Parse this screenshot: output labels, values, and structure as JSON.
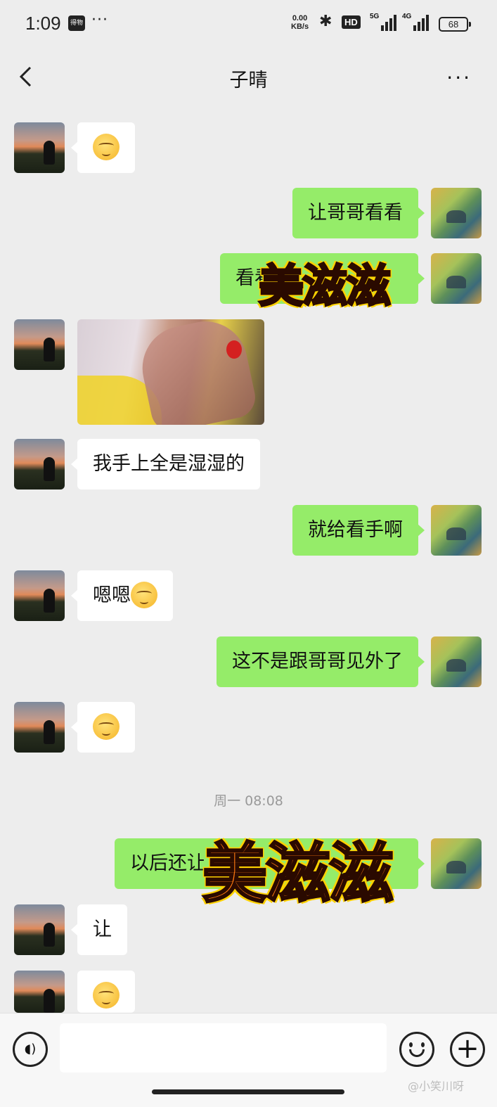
{
  "status_bar": {
    "time": "1:09",
    "app_badge": "得物",
    "dots": "···",
    "speed_value": "0.00",
    "speed_unit": "KB/s",
    "hd": "HD",
    "sig1": "5G",
    "sig2": "4G",
    "battery": "68"
  },
  "header": {
    "title": "子晴",
    "more": "···"
  },
  "messages": {
    "m2": "让哥哥看看",
    "m3": "看看",
    "m5": "我手上全是湿湿的",
    "m6": "就给看手啊",
    "m7": "嗯嗯",
    "m8": "这不是跟哥哥见外了",
    "m10": "以后还让",
    "m11": "让"
  },
  "timestamp": "周一 08:08",
  "sticker_text": "美滋滋",
  "watermark": "@小笑川呀"
}
